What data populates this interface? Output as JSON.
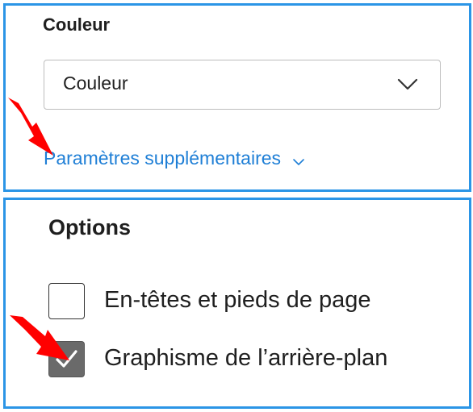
{
  "color_section": {
    "title": "Couleur",
    "select": {
      "value": "Couleur",
      "icon": "chevron-down-icon"
    },
    "more_settings_link": {
      "label": "Paramètres supplémentaires",
      "icon": "chevron-down-icon"
    }
  },
  "options_section": {
    "title": "Options",
    "checkboxes": [
      {
        "label": "En-têtes et pieds de page",
        "checked": false
      },
      {
        "label": "Graphisme de l’arrière-plan",
        "checked": true
      }
    ]
  },
  "annotations": [
    {
      "icon": "red-arrow-icon",
      "color": "#ff0000"
    },
    {
      "icon": "red-arrow-icon",
      "color": "#ff0000"
    }
  ],
  "colors": {
    "highlight_border": "#2b95e6",
    "link": "#1f7fd6",
    "checkbox_checked": "#6a6a6a",
    "arrow": "#ff0000"
  }
}
